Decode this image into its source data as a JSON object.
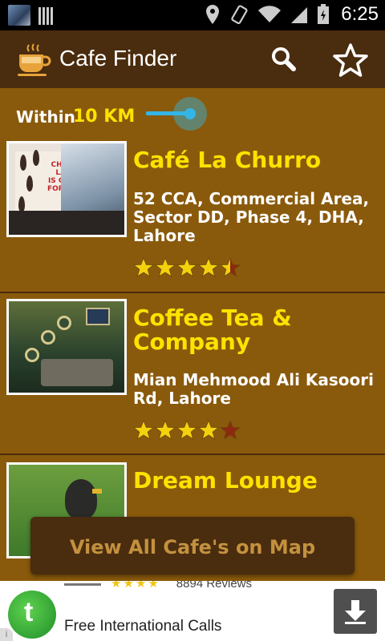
{
  "status_bar": {
    "time": "6:25",
    "icons": [
      "user-avatar-icon",
      "barcode-icon",
      "location-icon",
      "vibrate-icon",
      "wifi-icon",
      "signal-icon",
      "battery-icon"
    ]
  },
  "app_bar": {
    "title": "Cafe Finder",
    "logo_icon": "coffee-cup-icon",
    "actions": [
      "search-icon",
      "star-icon"
    ]
  },
  "range": {
    "label": "Within",
    "value": "10 KM",
    "slider_fraction": 0.2
  },
  "cafes": [
    {
      "name": "Café La Churro",
      "address": "52 CCA, Commercial Area, Sector DD, Phase 4, DHA, Lahore",
      "rating": 4.5,
      "photo_sign": [
        "CHOCO",
        "LATE",
        "IS GOOD",
        "FOR YOU"
      ]
    },
    {
      "name": "Coffee Tea & Company",
      "address": "Mian Mehmood Ali Kasoori Rd, Lahore",
      "rating": 4
    },
    {
      "name": "Dream Lounge",
      "address": "",
      "rating": null
    }
  ],
  "map_button": {
    "label": "View All Cafe's on Map"
  },
  "ad": {
    "rating_text": "8894 Reviews",
    "title": "Free International Calls",
    "info_glyph": "i"
  },
  "colors": {
    "background": "#8a5a0c",
    "header": "#4a2c0e",
    "name_yellow": "#ffe200",
    "star_filled": "#f4d10e",
    "star_empty": "#8c2a10",
    "slider": "#33b5e5"
  }
}
